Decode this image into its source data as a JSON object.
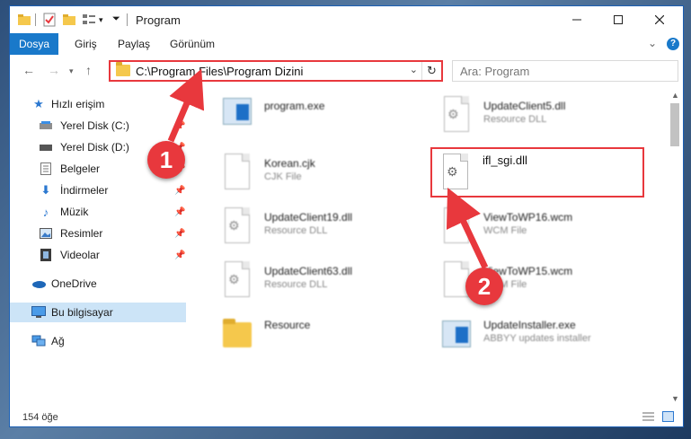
{
  "window": {
    "title": "Program"
  },
  "ribbon": {
    "tabs": [
      "Dosya",
      "Giriş",
      "Paylaş",
      "Görünüm"
    ],
    "active": "Dosya",
    "help": "?"
  },
  "nav": {
    "address": "C:\\Program Files\\Program Dizini",
    "search_placeholder": "Ara: Program"
  },
  "sidebar": {
    "items": [
      {
        "label": "Hızlı erişim",
        "icon": "star-icon",
        "pinned": false
      },
      {
        "label": "Yerel Disk (C:)",
        "icon": "drive-icon",
        "pinned": true
      },
      {
        "label": "Yerel Disk (D:)",
        "icon": "drive-icon",
        "pinned": true
      },
      {
        "label": "Belgeler",
        "icon": "documents-icon",
        "pinned": true
      },
      {
        "label": "İndirmeler",
        "icon": "download-icon",
        "pinned": true
      },
      {
        "label": "Müzik",
        "icon": "music-icon",
        "pinned": true
      },
      {
        "label": "Resimler",
        "icon": "pictures-icon",
        "pinned": true
      },
      {
        "label": "Videolar",
        "icon": "video-icon",
        "pinned": true
      },
      {
        "label": "OneDrive",
        "icon": "cloud-icon",
        "pinned": false
      },
      {
        "label": "Bu bilgisayar",
        "icon": "computer-icon",
        "pinned": false,
        "selected": true
      },
      {
        "label": "Ağ",
        "icon": "network-icon",
        "pinned": false
      }
    ]
  },
  "files": [
    {
      "name": "program.exe",
      "desc": "",
      "type": "exe"
    },
    {
      "name": "UpdateClient5.dll",
      "desc": "Resource DLL",
      "type": "dll"
    },
    {
      "name": "Korean.cjk",
      "desc": "CJK File",
      "type": "doc"
    },
    {
      "name": "ifl_sgi.dll",
      "desc": "",
      "type": "dll",
      "highlighted": true
    },
    {
      "name": "UpdateClient19.dll",
      "desc": "Resource DLL",
      "type": "dll"
    },
    {
      "name": "ViewToWP16.wcm",
      "desc": "WCM File",
      "type": "doc"
    },
    {
      "name": "UpdateClient63.dll",
      "desc": "Resource DLL",
      "type": "dll"
    },
    {
      "name": "ViewToWP15.wcm",
      "desc": "WCM File",
      "type": "doc"
    },
    {
      "name": "Resource",
      "desc": "",
      "type": "folder"
    },
    {
      "name": "UpdateInstaller.exe",
      "desc": "ABBYY updates installer",
      "type": "installer"
    }
  ],
  "status": {
    "count": "154 öğe"
  },
  "annotations": {
    "step1": "1",
    "step2": "2"
  },
  "colors": {
    "accent": "#1979ca",
    "annotation": "#e8383d",
    "selected_bg": "#cce4f7"
  }
}
